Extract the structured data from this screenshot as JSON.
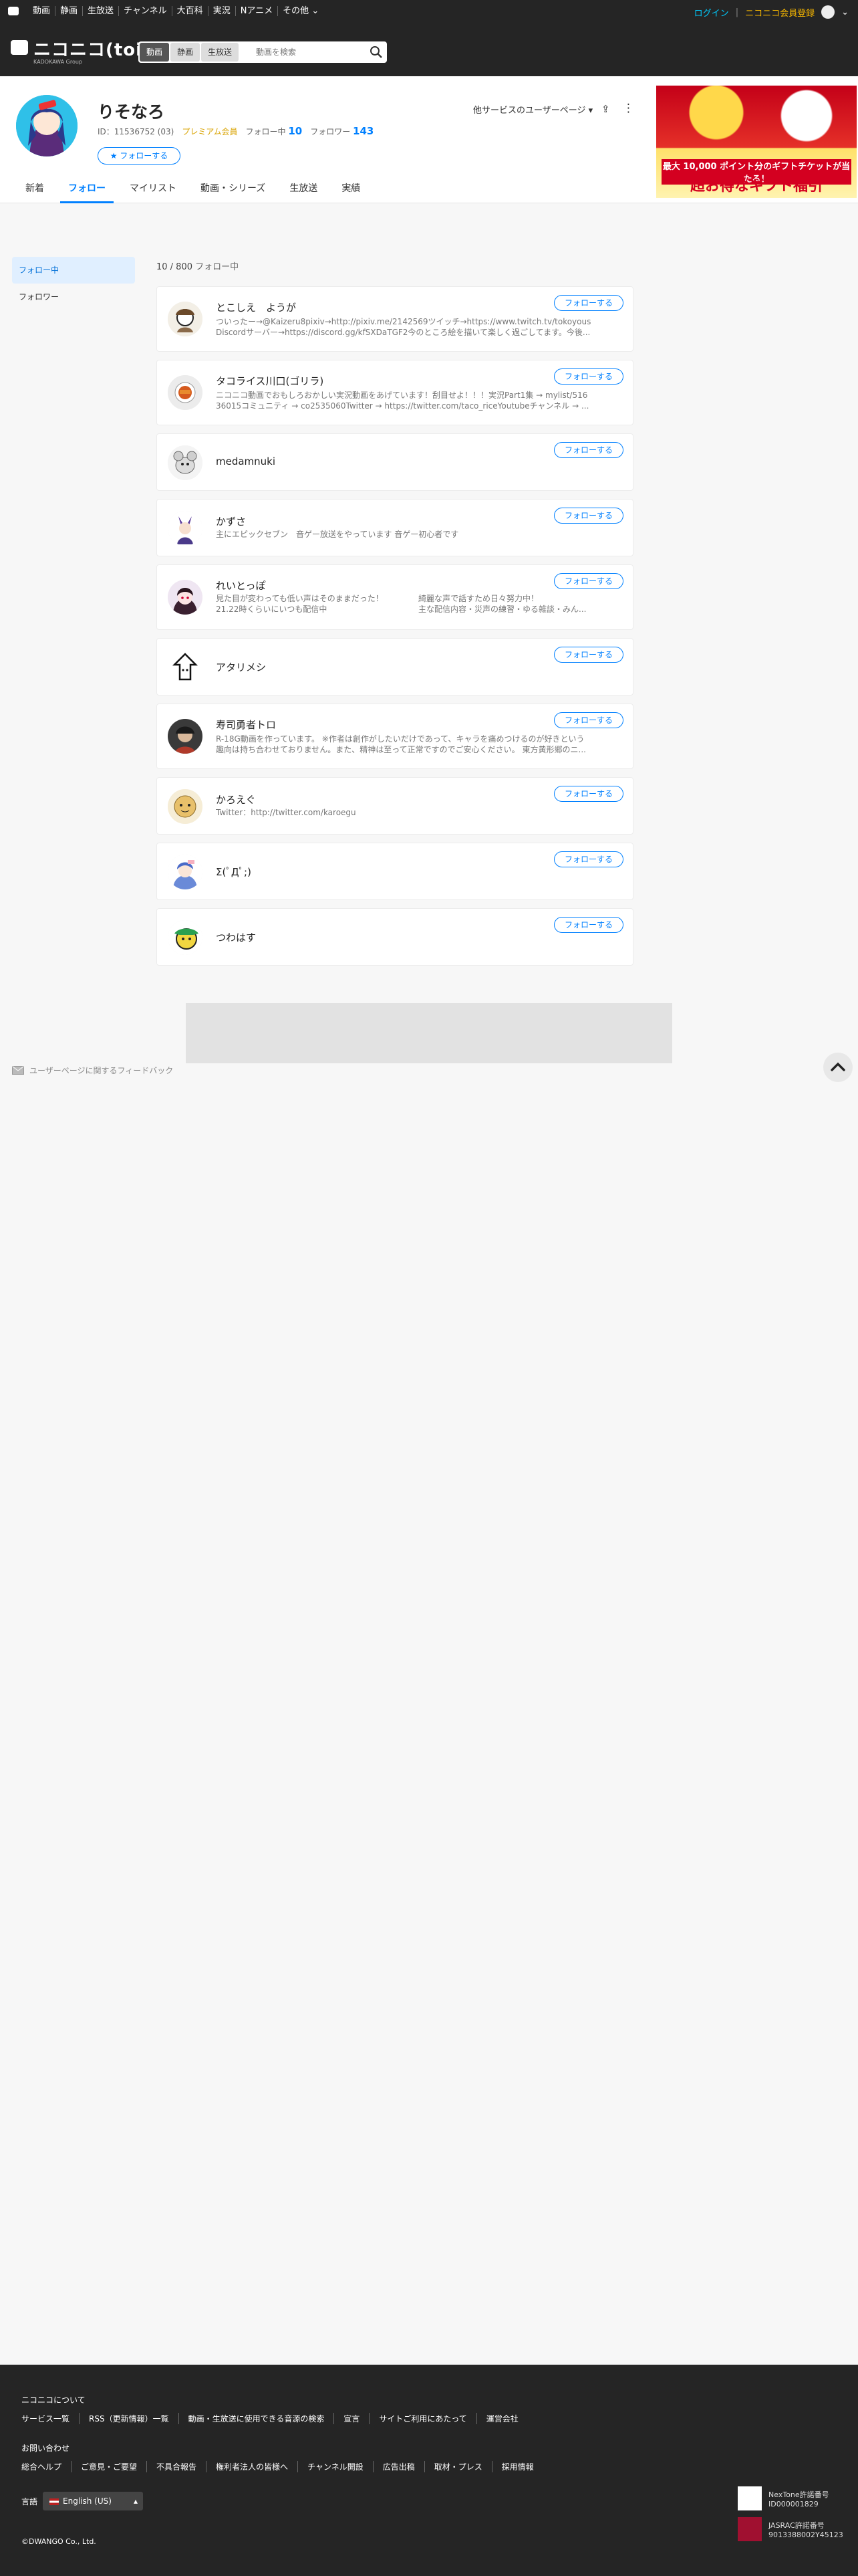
{
  "sysbar": {
    "links": [
      "動画",
      "静画",
      "生放送",
      "チャンネル",
      "大百科",
      "実況",
      "Nアニメ",
      "その他"
    ],
    "login": "ログイン",
    "separator": "|",
    "register": "ニコニコ会員登録"
  },
  "header": {
    "logo_text": "ニコニコ(toi)",
    "logo_sub": "KADOKAWA Group",
    "search_categories": [
      "動画",
      "静画",
      "生放送"
    ],
    "search_placeholder": "動画を検索"
  },
  "profile": {
    "name": "りそなろ",
    "id_label": "ID：11536752 (03)",
    "premium": "プレミアム会員",
    "following_label": "フォロー中",
    "following_count": "10",
    "followers_label": "フォロワー",
    "followers_count": "143",
    "follow_button": "★ フォローする",
    "other_services": "他サービスのユーザーページ ▾",
    "ad_line1": "最大 10,000 ポイント分のギフトチケットが当たる！",
    "ad_line2": "超お得なギフト福引"
  },
  "tabs": [
    "新着",
    "フォロー",
    "マイリスト",
    "動画・シリーズ",
    "生放送",
    "実績"
  ],
  "sidebar": [
    "フォロー中",
    "フォロワー"
  ],
  "list": {
    "count": "10 / 800",
    "count_label": "フォロー中",
    "follow_label": "フォローする",
    "users": [
      {
        "name": "とこしえ　ようが",
        "desc": [
          "ついったー→@Kaizeru8pixiv→http://pixiv.me/2142569ツイッチ→https://www.twitch.tv/tokoyous",
          "Discordサーバー→https://discord.gg/kfSXDaTGF2今のところ絵を描いて楽しく過ごしてます。今後..."
        ]
      },
      {
        "name": "タコライス川口(ゴリラ)",
        "desc": [
          "ニコニコ動画でおもしろおかしい実況動画をあげています！刮目せよ！！！実況Part1集 → mylist/516",
          "36015コミュニティ → co2535060Twitter → https://twitter.com/taco_riceYoutubeチャンネル → ..."
        ]
      },
      {
        "name": "medamnuki",
        "desc": []
      },
      {
        "name": "かずさ",
        "desc": [
          "主にエピックセブン　音ゲー放送をやっています 音ゲー初心者です"
        ]
      },
      {
        "name": "れいとっぽ",
        "desc": [
          "見た目が変わっても低い声はそのままだった！",
          "21.22時くらいにいつも配信中"
        ],
        "desc_right": [
          "綺麗な声で話すため日々努力中！",
          "主な配信内容・災声の練習・ゆる雑談・みん..."
        ]
      },
      {
        "name": "アタリメシ",
        "desc": []
      },
      {
        "name": "寿司勇者トロ",
        "desc": [
          "R-18G動画を作っています。 ※作者は創作がしたいだけであって、キャラを痛めつけるのが好きという",
          "趣向は持ち合わせておりません。また、精神は至って正常ですのでご安心ください。 東方黄形郷のニ..."
        ]
      },
      {
        "name": "かろえぐ",
        "desc": [
          "Twitter：http://twitter.com/karoegu"
        ]
      },
      {
        "name": "Σ(ﾟДﾟ;)",
        "desc": []
      },
      {
        "name": "つわはす",
        "desc": []
      }
    ]
  },
  "feedback": "ユーザーページに関するフィードバック",
  "footer": {
    "about_title": "ニコニコについて",
    "about_links": [
      "サービス一覧",
      "RSS（更新情報）一覧",
      "動画・生放送に使用できる音源の検索",
      "宣言",
      "サイトご利用にあたって",
      "運営会社"
    ],
    "contact_title": "お問い合わせ",
    "contact_links": [
      "総合ヘルプ",
      "ご意見・ご要望",
      "不具合報告",
      "権利者法人の皆様へ",
      "チャンネル開設",
      "広告出稿",
      "取材・プレス",
      "採用情報"
    ],
    "lang_label": "言語",
    "lang_value": "English (US)",
    "copyright": "©DWANGO Co., Ltd.",
    "license1_name": "NexTone許諾番号",
    "license1_no": "ID000001829",
    "license2_name": "JASRAC許諾番号",
    "license2_no": "9013388002Y45123"
  },
  "colors": {
    "accent": "#0080ff",
    "dark": "#252525",
    "premium": "#d9a300"
  }
}
